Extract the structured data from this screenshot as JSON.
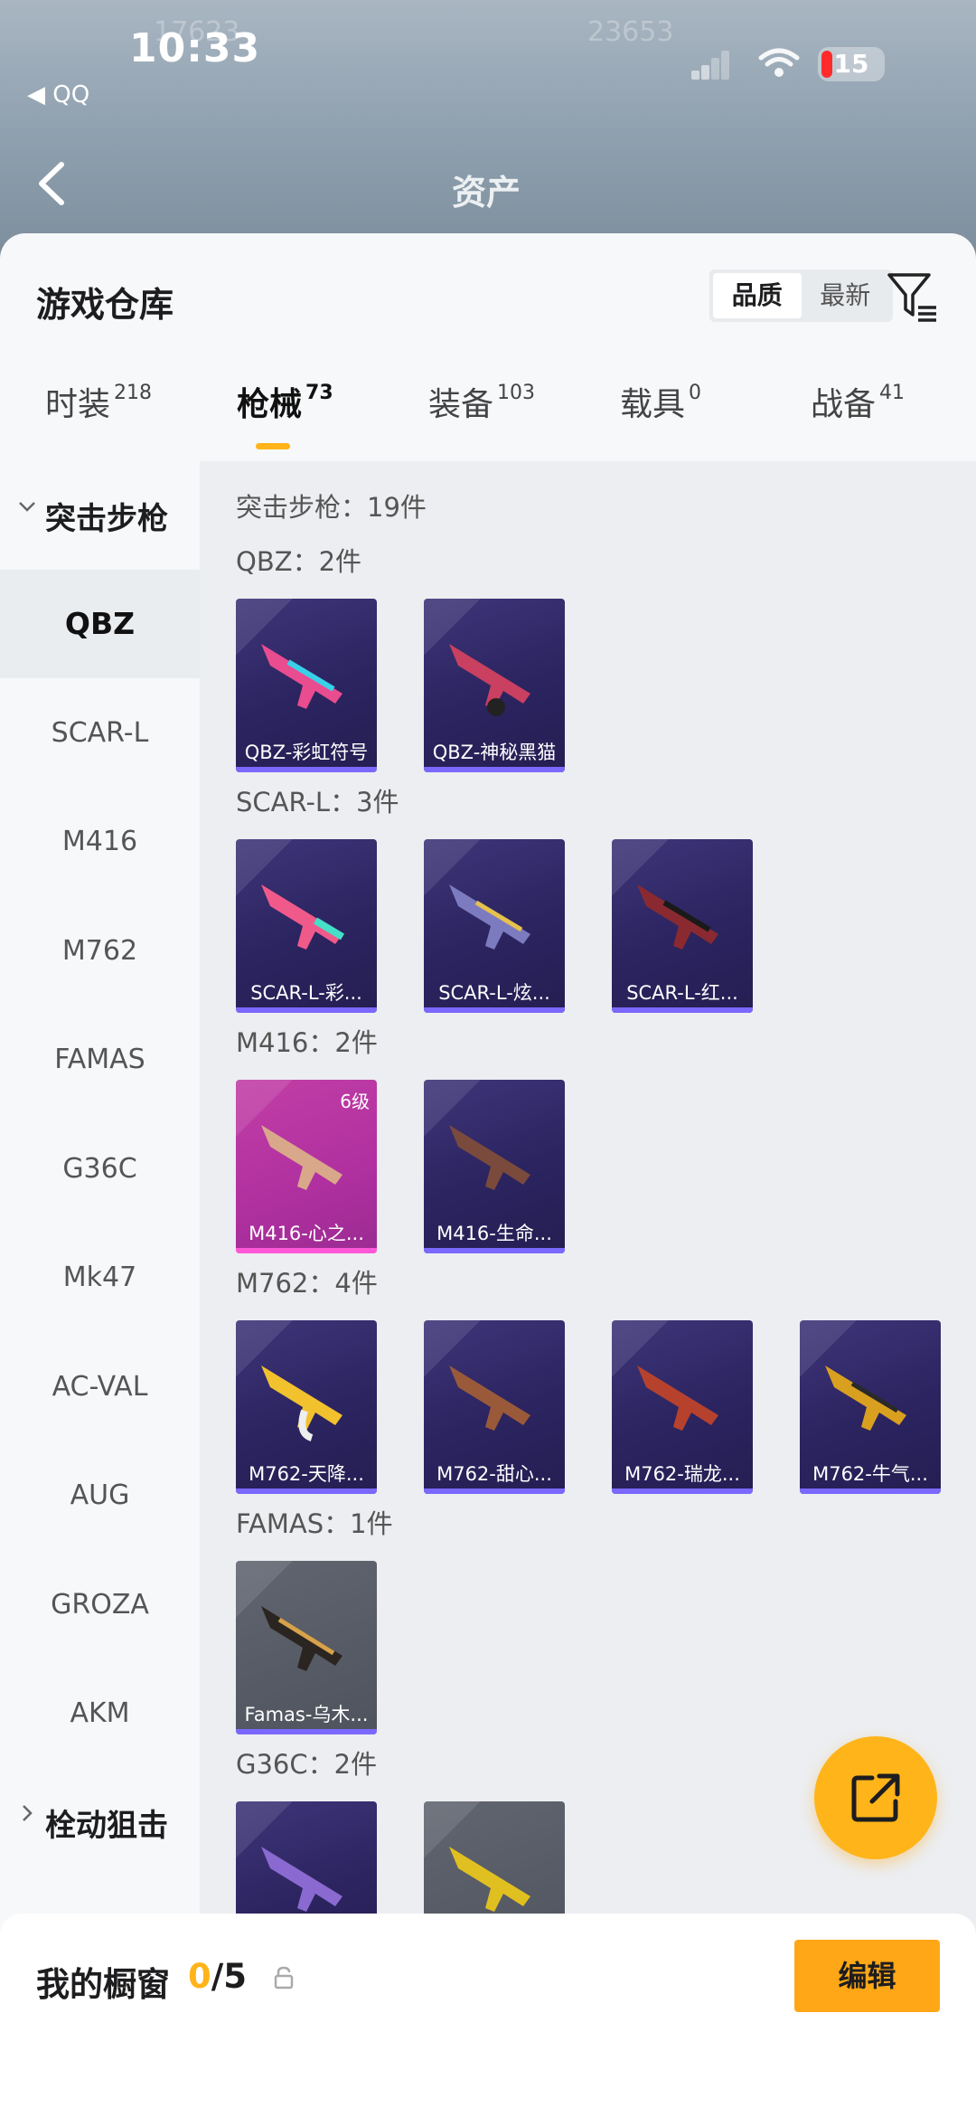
{
  "status_bar": {
    "time": "10:33",
    "back_app": "◀ QQ",
    "battery": "15"
  },
  "header": {
    "title": "资产"
  },
  "sheet": {
    "title": "游戏仓库",
    "sort": {
      "quality": "品质",
      "newest": "最新"
    }
  },
  "tabs": [
    {
      "label": "时装",
      "count": "218"
    },
    {
      "label": "枪械",
      "count": "73"
    },
    {
      "label": "装备",
      "count": "103"
    },
    {
      "label": "载具",
      "count": "0"
    },
    {
      "label": "战备",
      "count": "41"
    }
  ],
  "sidebar": {
    "group_open": "突击步枪",
    "items": [
      "QBZ",
      "SCAR-L",
      "M416",
      "M762",
      "FAMAS",
      "G36C",
      "Mk47",
      "AC-VAL",
      "AUG",
      "GROZA",
      "AKM"
    ],
    "group_closed": "栓动狙击"
  },
  "content": {
    "summary": "突击步枪：19件",
    "sections": [
      {
        "title": "QBZ：2件",
        "items": [
          "QBZ-彩虹符号",
          "QBZ-神秘黑猫"
        ]
      },
      {
        "title": "SCAR-L：3件",
        "items": [
          "SCAR-L-彩...",
          "SCAR-L-炫...",
          "SCAR-L-红..."
        ]
      },
      {
        "title": "M416：2件",
        "items": [
          "M416-心之...",
          "M416-生命..."
        ],
        "level": "6级"
      },
      {
        "title": "M762：4件",
        "items": [
          "M762-天降...",
          "M762-甜心...",
          "M762-瑞龙...",
          "M762-牛气..."
        ]
      },
      {
        "title": "FAMAS：1件",
        "items": [
          "Famas-乌木..."
        ]
      },
      {
        "title": "G36C：2件",
        "items": [
          "",
          ""
        ]
      }
    ]
  },
  "bottom_bar": {
    "title": "我的橱窗",
    "current": "0",
    "total": "/5",
    "edit": "编辑"
  },
  "colors": {
    "accent": "#ffb41a",
    "card_purple": "#2c2460",
    "card_pink": "#b030a0"
  }
}
